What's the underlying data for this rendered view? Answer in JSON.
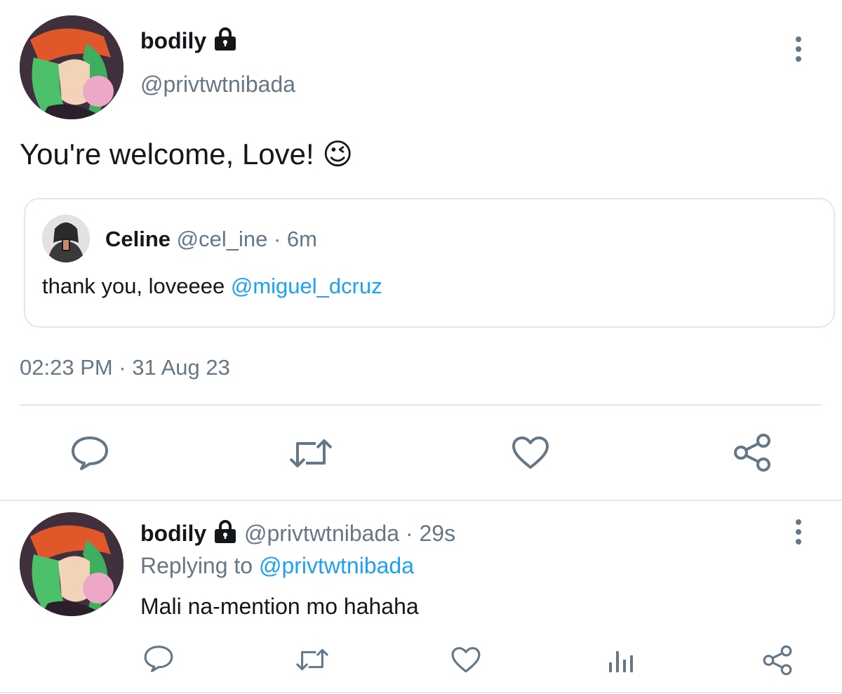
{
  "main_tweet": {
    "display_name": "bodily",
    "handle": "@privtwtnibada",
    "text": "You're welcome, Love!",
    "emoji": "😉",
    "timestamp": "02:23 PM · 31 Aug 23",
    "avatar_icon": "user-avatar-green-hair",
    "lock_icon": "lock-icon"
  },
  "quoted_tweet": {
    "display_name": "Celine",
    "handle_time": "@cel_ine · 6m",
    "text": "thank you, loveeee ",
    "mention": "@miguel_dcruz"
  },
  "reply": {
    "display_name": "bodily",
    "handle_time": "@privtwtnibada · 29s",
    "replying_prefix": "Replying to ",
    "replying_handle": "@privtwtnibada",
    "text": "Mali na-mention mo hahaha"
  },
  "actions": [
    "comment-icon",
    "retweet-icon",
    "heart-icon",
    "share-icon",
    "analytics-icon"
  ],
  "colors": {
    "accent": "#1da1f2",
    "muted": "#657786",
    "text": "#14171a",
    "divider": "#e1e8ed"
  }
}
